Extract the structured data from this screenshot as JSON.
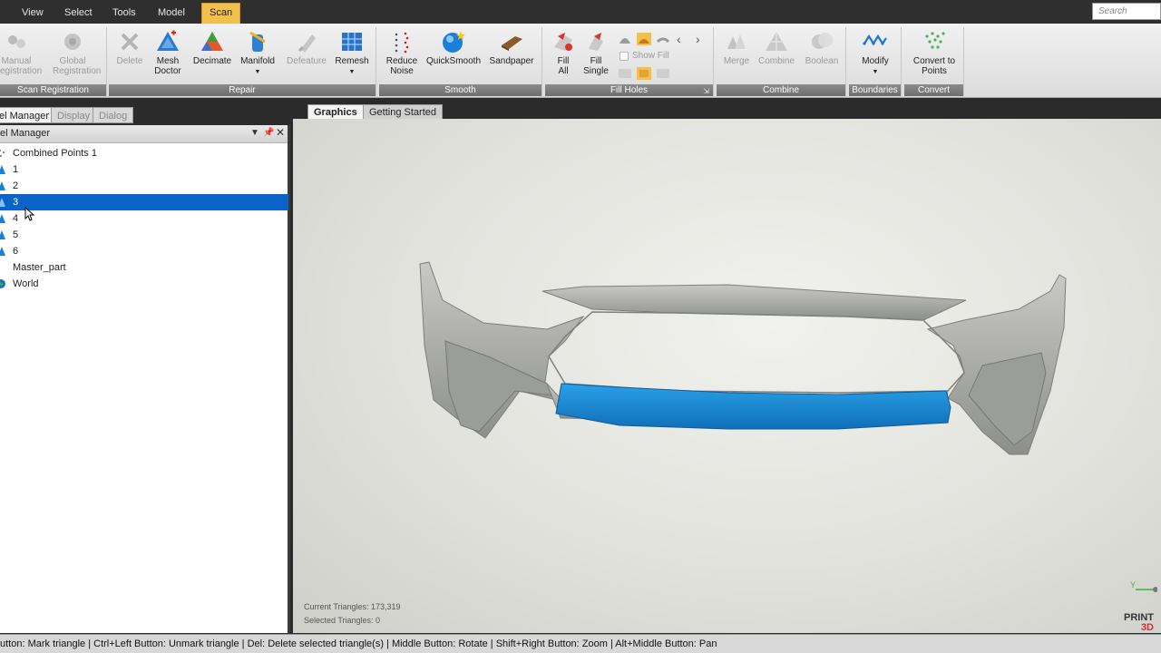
{
  "menu": {
    "items": [
      "View",
      "Select",
      "Tools",
      "Model",
      "Scan"
    ],
    "active": "Scan",
    "search_placeholder": "Search"
  },
  "ribbon": {
    "groups": [
      {
        "label": "Scan Registration",
        "buttons": [
          {
            "label1": "Manual",
            "label2": "egistration",
            "enabled": false,
            "icon": "manual-registration-icon"
          },
          {
            "label1": "Global",
            "label2": "Registration",
            "enabled": false,
            "icon": "global-registration-icon"
          }
        ]
      },
      {
        "label": "Repair",
        "buttons": [
          {
            "label1": "Delete",
            "label2": "",
            "enabled": false,
            "icon": "delete-icon"
          },
          {
            "label1": "Mesh",
            "label2": "Doctor",
            "enabled": true,
            "icon": "mesh-doctor-icon"
          },
          {
            "label1": "Decimate",
            "label2": "",
            "enabled": true,
            "icon": "decimate-icon"
          },
          {
            "label1": "Manifold",
            "label2": "",
            "enabled": true,
            "icon": "manifold-icon"
          },
          {
            "label1": "Defeature",
            "label2": "",
            "enabled": false,
            "icon": "defeature-icon"
          },
          {
            "label1": "Remesh",
            "label2": "",
            "enabled": true,
            "icon": "remesh-icon"
          }
        ]
      },
      {
        "label": "Smooth",
        "buttons": [
          {
            "label1": "Reduce",
            "label2": "Noise",
            "enabled": true,
            "icon": "reduce-noise-icon"
          },
          {
            "label1": "QuickSmooth",
            "label2": "",
            "enabled": true,
            "icon": "quicksmooth-icon"
          },
          {
            "label1": "Sandpaper",
            "label2": "",
            "enabled": true,
            "icon": "sandpaper-icon"
          }
        ]
      },
      {
        "label": "Fill Holes",
        "buttons": [
          {
            "label1": "Fill",
            "label2": "All",
            "enabled": true,
            "icon": "fill-all-icon"
          },
          {
            "label1": "Fill",
            "label2": "Single",
            "enabled": true,
            "icon": "fill-single-icon"
          }
        ],
        "show_fill": "Show Fill"
      },
      {
        "label": "Combine",
        "buttons": [
          {
            "label1": "Merge",
            "label2": "",
            "enabled": false,
            "icon": "merge-icon"
          },
          {
            "label1": "Combine",
            "label2": "",
            "enabled": false,
            "icon": "combine-icon"
          },
          {
            "label1": "Boolean",
            "label2": "",
            "enabled": false,
            "icon": "boolean-icon"
          }
        ]
      },
      {
        "label": "Boundaries",
        "buttons": [
          {
            "label1": "Modify",
            "label2": "",
            "enabled": true,
            "icon": "modify-icon"
          }
        ]
      },
      {
        "label": "Convert",
        "buttons": [
          {
            "label1": "Convert to",
            "label2": "Points",
            "enabled": true,
            "icon": "convert-to-points-icon"
          }
        ]
      }
    ]
  },
  "panel": {
    "tabs": [
      "el Manager",
      "Display",
      "Dialog"
    ],
    "active_tab": "el Manager",
    "title": "el Manager",
    "tree": [
      {
        "label": "Combined Points 1",
        "icon": "points-icon",
        "selected": false
      },
      {
        "label": "1",
        "icon": "mesh-icon",
        "selected": false
      },
      {
        "label": "2",
        "icon": "mesh-icon",
        "selected": false
      },
      {
        "label": "3",
        "icon": "mesh-icon",
        "selected": true
      },
      {
        "label": "4",
        "icon": "mesh-icon",
        "selected": false
      },
      {
        "label": "5",
        "icon": "mesh-icon",
        "selected": false
      },
      {
        "label": "6",
        "icon": "mesh-icon",
        "selected": false
      },
      {
        "label": "Master_part",
        "icon": "part-icon",
        "selected": false
      },
      {
        "label": "World",
        "icon": "world-icon",
        "selected": false
      }
    ]
  },
  "viewport": {
    "tabs": [
      "Graphics",
      "Getting Started"
    ],
    "active_tab": "Graphics",
    "current_triangles": "Current Triangles: 173,319",
    "selected_triangles": "Selected Triangles: 0",
    "model_color": "#a9aba7",
    "highlight_color": "#1a8fd6",
    "logo_line1": "PRINT",
    "logo_line2": "3D",
    "axis_label": "Y"
  },
  "status": {
    "text": "utton: Mark triangle | Ctrl+Left Button: Unmark triangle | Del: Delete selected triangle(s) | Middle Button: Rotate | Shift+Right Button: Zoom | Alt+Middle Button: Pan"
  }
}
